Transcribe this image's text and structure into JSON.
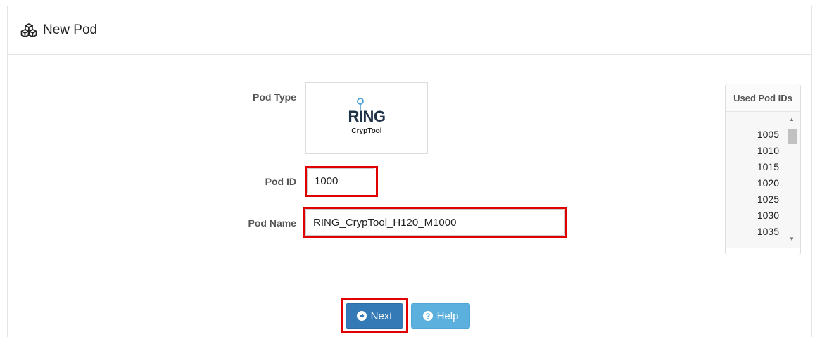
{
  "header": {
    "title": "New Pod",
    "icon": "cubes-icon"
  },
  "form": {
    "pod_type_label": "Pod Type",
    "pod_type_logo": {
      "title": "RING",
      "subtitle": "CrypTool"
    },
    "pod_id_label": "Pod ID",
    "pod_id_value": "1000",
    "pod_name_label": "Pod Name",
    "pod_name_value": "RING_CrypTool_H120_M1000"
  },
  "used_pod_ids": {
    "title": "Used Pod IDs",
    "items": [
      "1005",
      "1010",
      "1015",
      "1020",
      "1025",
      "1030",
      "1035"
    ]
  },
  "footer": {
    "next_label": "Next",
    "help_label": "Help"
  },
  "colors": {
    "primary": "#337ab7",
    "info": "#5bb0de",
    "highlight": "#e00000"
  }
}
